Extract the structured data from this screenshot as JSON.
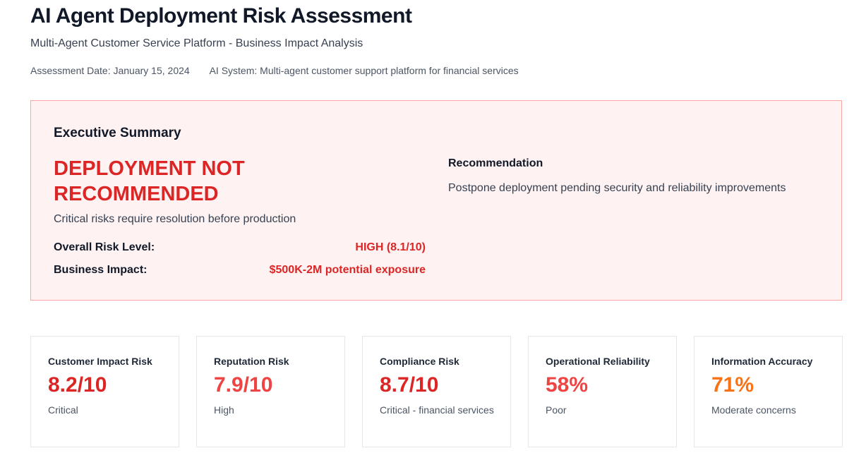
{
  "header": {
    "title": "AI Agent Deployment Risk Assessment",
    "subtitle": "Multi-Agent Customer Service Platform - Business Impact Analysis",
    "assessment_date": "Assessment Date: January 15, 2024",
    "ai_system": "AI System: Multi-agent customer support platform for financial services"
  },
  "summary": {
    "heading": "Executive Summary",
    "verdict": "DEPLOYMENT NOT RECOMMENDED",
    "verdict_note": "Critical risks require resolution before production",
    "overall_risk_label": "Overall Risk Level:",
    "overall_risk_value": "HIGH (8.1/10)",
    "business_impact_label": "Business Impact:",
    "business_impact_value": "$500K-2M potential exposure",
    "recommendation_heading": "Recommendation",
    "recommendation_text": "Postpone deployment pending security and reliability improvements"
  },
  "metrics": [
    {
      "label": "Customer Impact Risk",
      "value": "8.2/10",
      "status": "Critical",
      "color": "#dc2626"
    },
    {
      "label": "Reputation Risk",
      "value": "7.9/10",
      "status": "High",
      "color": "#ef4444"
    },
    {
      "label": "Compliance Risk",
      "value": "8.7/10",
      "status": "Critical - financial services",
      "color": "#dc2626"
    },
    {
      "label": "Operational Reliability",
      "value": "58%",
      "status": "Poor",
      "color": "#ef4444"
    },
    {
      "label": "Information Accuracy",
      "value": "71%",
      "status": "Moderate concerns",
      "color": "#f97316"
    }
  ],
  "colors": {
    "danger": "#dc2626",
    "summary_background": "#fef2f2",
    "summary_border": "#fca5a5"
  }
}
